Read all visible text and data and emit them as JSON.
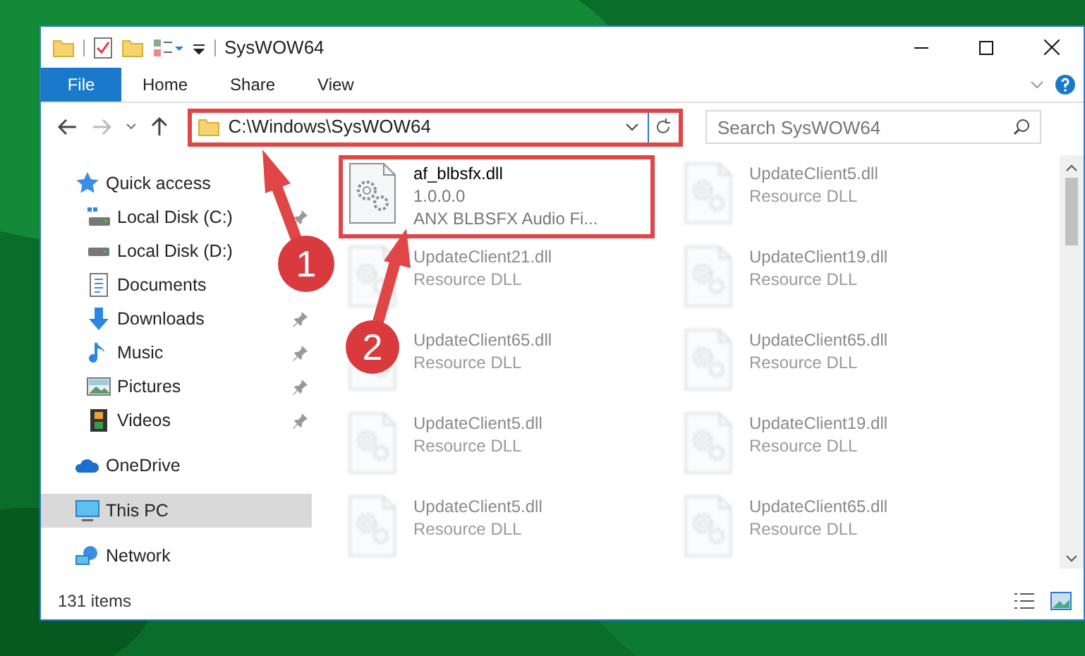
{
  "window": {
    "title": "SysWOW64"
  },
  "ribbon_tabs": [
    {
      "label": "File",
      "selected": true
    },
    {
      "label": "Home",
      "selected": false
    },
    {
      "label": "Share",
      "selected": false
    },
    {
      "label": "View",
      "selected": false
    }
  ],
  "address": {
    "path": "C:\\Windows\\SysWOW64"
  },
  "search": {
    "placeholder": "Search SysWOW64"
  },
  "sidebar": {
    "items": [
      {
        "label": "Quick access",
        "kind": "star",
        "selected": false,
        "children": [
          {
            "label": "Local Disk (C:)",
            "kind": "system-drive",
            "pinned": true
          },
          {
            "label": "Local Disk (D:)",
            "kind": "drive",
            "pinned": false
          },
          {
            "label": "Documents",
            "kind": "documents",
            "pinned": false
          },
          {
            "label": "Downloads",
            "kind": "downloads",
            "pinned": true
          },
          {
            "label": "Music",
            "kind": "music",
            "pinned": true
          },
          {
            "label": "Pictures",
            "kind": "pictures",
            "pinned": true
          },
          {
            "label": "Videos",
            "kind": "videos",
            "pinned": true
          }
        ]
      },
      {
        "label": "OneDrive",
        "kind": "cloud",
        "selected": false
      },
      {
        "label": "This PC",
        "kind": "pc",
        "selected": true
      },
      {
        "label": "Network",
        "kind": "network",
        "selected": false
      }
    ]
  },
  "files": [
    {
      "name": "af_blbsfx.dll",
      "details": [
        "1.0.0.0",
        "ANX BLBSFX Audio Fi..."
      ],
      "blurred": false
    },
    {
      "name": "UpdateClient5.dll",
      "details": [
        "Resource DLL"
      ],
      "blurred": true
    },
    {
      "name": "UpdateClient21.dll",
      "details": [
        "Resource DLL"
      ],
      "blurred": true
    },
    {
      "name": "UpdateClient19.dll",
      "details": [
        "Resource DLL"
      ],
      "blurred": true
    },
    {
      "name": "UpdateClient65.dll",
      "details": [
        "Resource DLL"
      ],
      "blurred": true
    },
    {
      "name": "UpdateClient65.dll",
      "details": [
        "Resource DLL"
      ],
      "blurred": true
    },
    {
      "name": "UpdateClient5.dll",
      "details": [
        "Resource DLL"
      ],
      "blurred": true
    },
    {
      "name": "UpdateClient19.dll",
      "details": [
        "Resource DLL"
      ],
      "blurred": true
    },
    {
      "name": "UpdateClient5.dll",
      "details": [
        "Resource DLL"
      ],
      "blurred": true
    },
    {
      "name": "UpdateClient65.dll",
      "details": [
        "Resource DLL"
      ],
      "blurred": true
    }
  ],
  "status_bar": {
    "item_count": "131 items"
  },
  "annotations": [
    {
      "number": "1"
    },
    {
      "number": "2"
    }
  ]
}
